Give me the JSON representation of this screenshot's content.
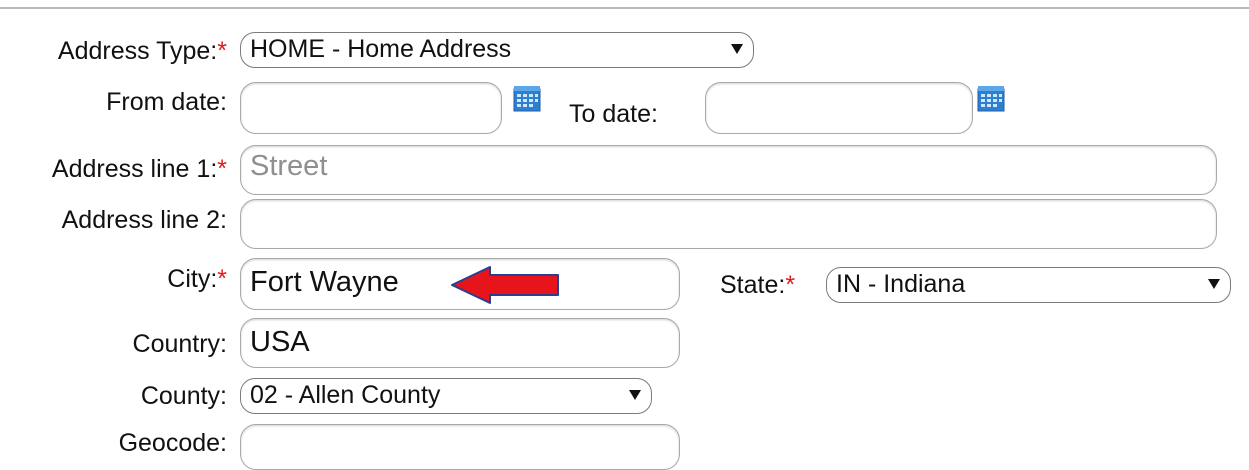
{
  "form": {
    "address_type": {
      "label": "Address Type:",
      "required_mark": "*",
      "value": "HOME - Home Address"
    },
    "from_date": {
      "label": "From date:",
      "value": "",
      "icon": "calendar-icon"
    },
    "to_date": {
      "label": "To date:",
      "value": "",
      "icon": "calendar-icon"
    },
    "address_line1": {
      "label": "Address line 1:",
      "required_mark": "*",
      "value": "",
      "placeholder": "Street"
    },
    "address_line2": {
      "label": "Address line 2:",
      "value": ""
    },
    "city": {
      "label": "City:",
      "required_mark": "*",
      "value": "Fort Wayne"
    },
    "state": {
      "label": "State:",
      "required_mark": "*",
      "value": "IN - Indiana"
    },
    "country": {
      "label": "Country:",
      "value": "USA"
    },
    "county": {
      "label": "County:",
      "value": "02 - Allen County"
    },
    "geocode": {
      "label": "Geocode:",
      "value": ""
    }
  },
  "annotation": {
    "type": "arrow",
    "pointing": "left",
    "color": "#e8141b",
    "outline": "#2a3f8f"
  }
}
